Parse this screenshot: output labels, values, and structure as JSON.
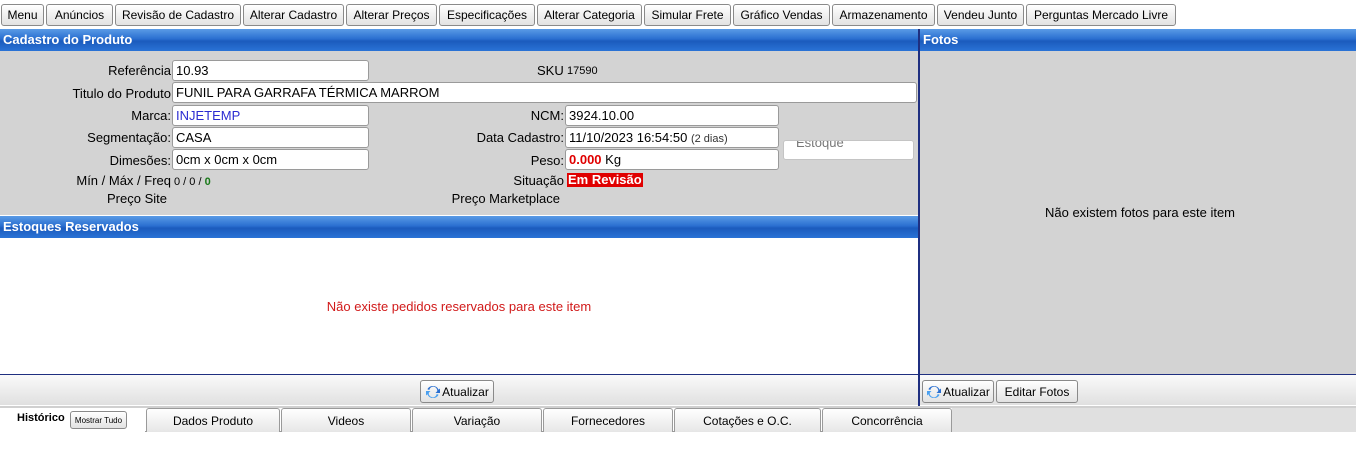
{
  "topbar": {
    "buttons": [
      "Menu",
      "Anúncios",
      "Revisão de Cadastro",
      "Alterar Cadastro",
      "Alterar Preços",
      "Especificações",
      "Alterar Categoria",
      "Simular Frete",
      "Gráfico Vendas",
      "Armazenamento",
      "Vendeu Junto",
      "Perguntas Mercado Livre"
    ]
  },
  "cadastro": {
    "title": "Cadastro do Produto",
    "referencia_label": "Referência",
    "referencia_value": "10.93",
    "sku_label": "SKU",
    "sku_value": "17590",
    "titulo_label": "Titulo do Produto",
    "titulo_value": "FUNIL PARA GARRAFA TÉRMICA MARROM",
    "marca_label": "Marca:",
    "marca_value": "INJETEMP",
    "ncm_label": "NCM:",
    "ncm_value": "3924.10.00",
    "segmentacao_label": "Segmentação:",
    "segmentacao_value": "CASA",
    "data_cadastro_label": "Data Cadastro:",
    "data_cadastro_value": "11/10/2023 16:54:50",
    "data_cadastro_age": "(2 dias)",
    "estoque_placeholder": "Estoque",
    "dimensoes_label": "Dimesões:",
    "dimensoes_value": "0cm x 0cm x 0cm",
    "peso_label": "Peso:",
    "peso_value": "0.000",
    "peso_unit": "Kg",
    "minmax_label": "Mín / Máx / Freq",
    "minmax_value": "0 / 0 /",
    "freq_value": "0",
    "situacao_label": "Situação",
    "situacao_value": "Em Revisão",
    "preco_site_label": "Preço Site",
    "preco_marketplace_label": "Preço Marketplace"
  },
  "estoques": {
    "title": "Estoques Reservados",
    "empty_message": "Não existe pedidos reservados para este item",
    "refresh_label": "Atualizar"
  },
  "fotos": {
    "title": "Fotos",
    "empty_message": "Não existem fotos para este item",
    "refresh_label": "Atualizar",
    "edit_label": "Editar Fotos"
  },
  "bottom_tabs": {
    "historico_label": "Histórico",
    "mostrar_tudo_label": "Mostrar Tudo",
    "tabs": [
      "Dados Produto",
      "Videos",
      "Variação",
      "Fornecedores",
      "Cotações e O.C.",
      "Concorrência"
    ]
  },
  "colors": {
    "header_blue": "#2a6fd0",
    "panel_gray": "#d3d3d3",
    "alert_red": "#d11a1a",
    "status_bg": "#e00000",
    "link_blue": "#2b2bd1",
    "freq_green": "#1a7a1a"
  }
}
